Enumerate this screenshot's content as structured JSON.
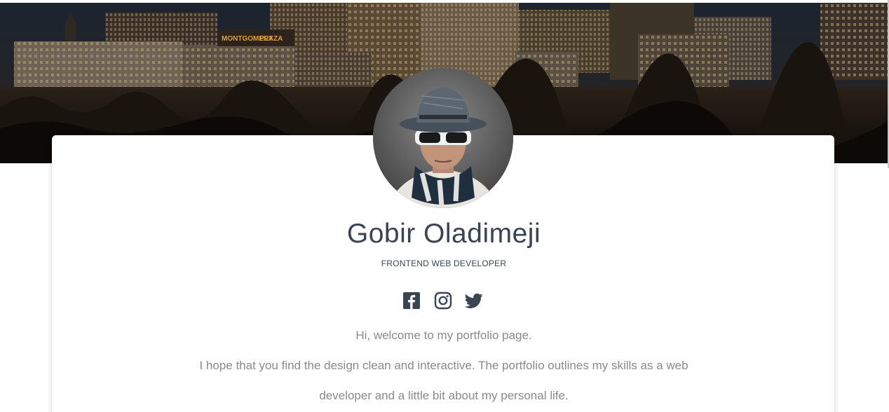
{
  "profile": {
    "name": "Gobir Oladimeji",
    "title": "FRONTEND WEB DEVELOPER"
  },
  "hero": {
    "signs": [
      "MONTGOMERY",
      "PLAZA"
    ]
  },
  "socials": [
    {
      "icon": "facebook-icon"
    },
    {
      "icon": "instagram-icon"
    },
    {
      "icon": "twitter-icon"
    }
  ],
  "intro": {
    "line1": "Hi, welcome to my portfolio page.",
    "line2": "I hope that you find the design clean and interactive. The portfolio outlines my skills as a web",
    "line3": "developer and a little bit about my personal life."
  },
  "colors": {
    "heading": "#3a4452",
    "body_text": "#8a8a8a",
    "icon": "#3a4452"
  }
}
